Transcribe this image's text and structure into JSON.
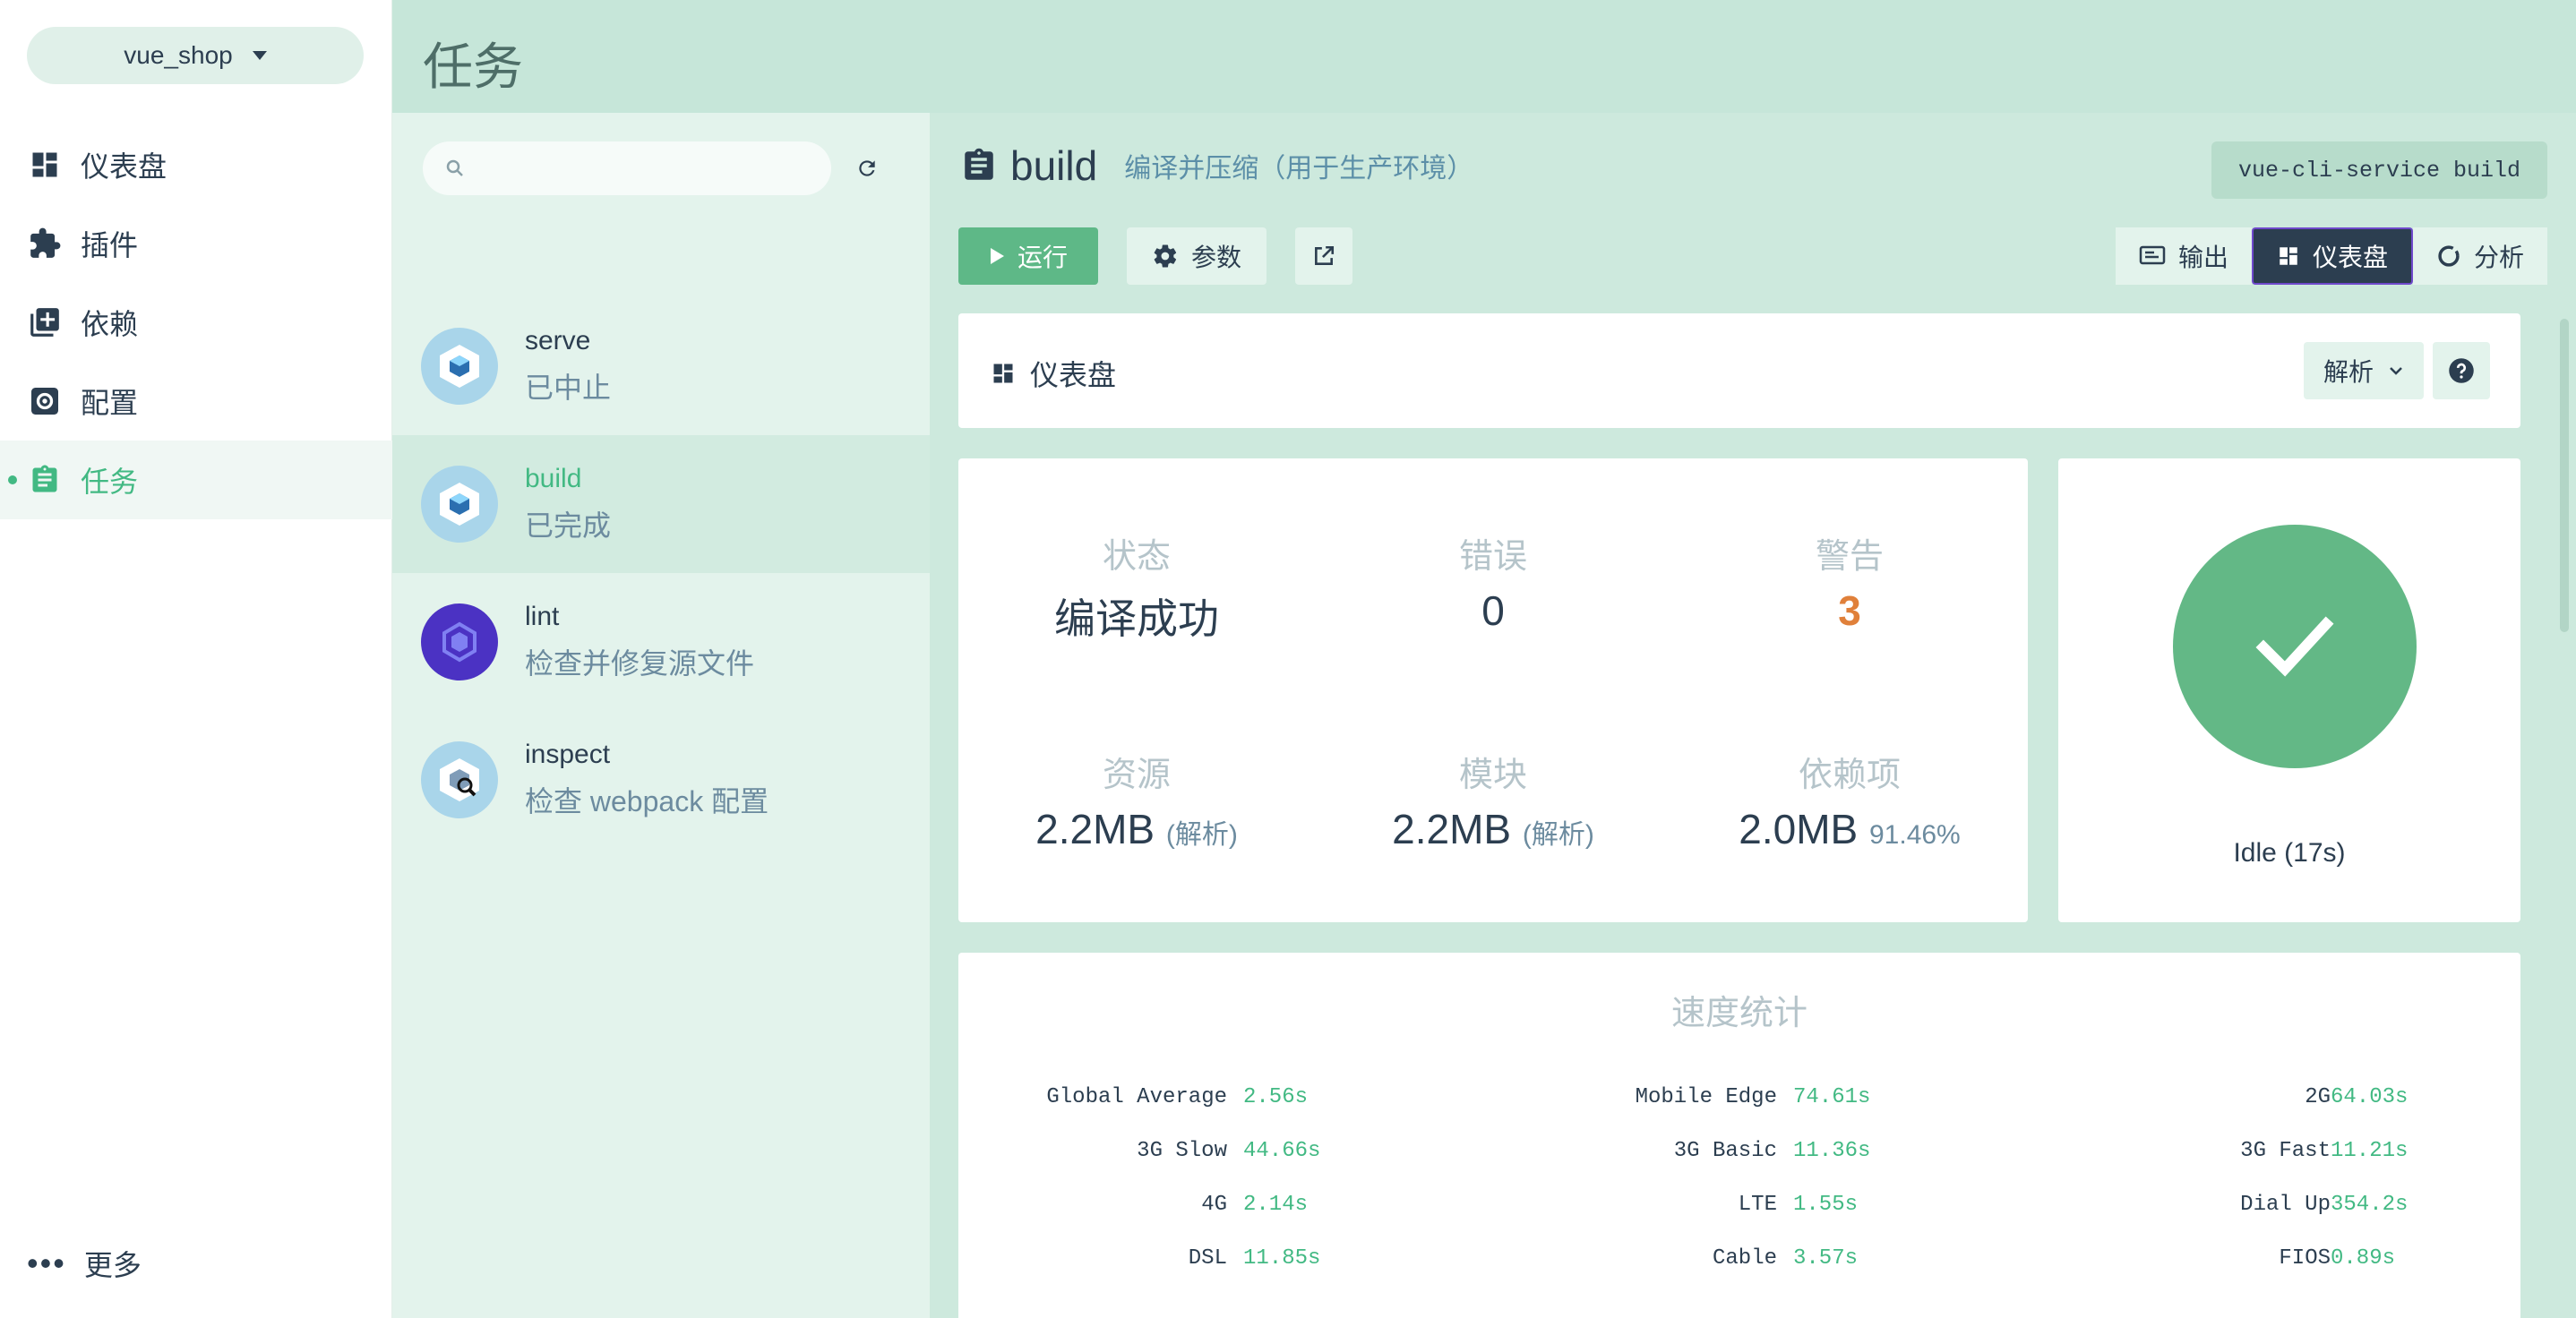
{
  "sidebar": {
    "project": "vue_shop",
    "items": [
      {
        "label": "仪表盘"
      },
      {
        "label": "插件"
      },
      {
        "label": "依赖"
      },
      {
        "label": "配置"
      },
      {
        "label": "任务"
      }
    ],
    "more": "更多"
  },
  "header": {
    "title": "任务"
  },
  "tasks": {
    "search_placeholder": "",
    "items": [
      {
        "name": "serve",
        "desc": "已中止"
      },
      {
        "name": "build",
        "desc": "已完成"
      },
      {
        "name": "lint",
        "desc": "检查并修复源文件"
      },
      {
        "name": "inspect",
        "desc": "检查 webpack 配置"
      }
    ]
  },
  "task": {
    "title": "build",
    "subtitle": "编译并压缩（用于生产环境）",
    "command": "vue-cli-service build",
    "run_label": "运行",
    "params_label": "参数",
    "tabs": [
      "输出",
      "仪表盘",
      "分析"
    ]
  },
  "dashboard": {
    "title": "仪表盘",
    "analysis_label": "解析",
    "stats": {
      "status_label": "状态",
      "status_value": "编译成功",
      "errors_label": "错误",
      "errors_value": "0",
      "warnings_label": "警告",
      "warnings_value": "3",
      "assets_label": "资源",
      "assets_value": "2.2MB",
      "assets_note": "(解析)",
      "modules_label": "模块",
      "modules_value": "2.2MB",
      "modules_note": "(解析)",
      "deps_label": "依赖项",
      "deps_value": "2.0MB",
      "deps_note": "91.46%"
    },
    "status_text": "Idle (17s)",
    "speed": {
      "title": "速度统计",
      "rows": [
        [
          {
            "name": "Global Average",
            "value": "2.56s"
          },
          {
            "name": "Mobile Edge",
            "value": "74.61s"
          },
          {
            "name": "2G",
            "value": "64.03s"
          }
        ],
        [
          {
            "name": "3G Slow",
            "value": "44.66s"
          },
          {
            "name": "3G Basic",
            "value": "11.36s"
          },
          {
            "name": "3G Fast",
            "value": "11.21s"
          }
        ],
        [
          {
            "name": "4G",
            "value": "2.14s"
          },
          {
            "name": "LTE",
            "value": "1.55s"
          },
          {
            "name": "Dial Up",
            "value": "354.2s"
          }
        ],
        [
          {
            "name": "DSL",
            "value": "11.85s"
          },
          {
            "name": "Cable",
            "value": "3.57s"
          },
          {
            "name": "FIOS",
            "value": "0.89s"
          }
        ]
      ]
    }
  },
  "colors": {
    "accent": "#42b983",
    "dark": "#2c3e50",
    "warning": "#e0803a",
    "success": "#63b886"
  }
}
